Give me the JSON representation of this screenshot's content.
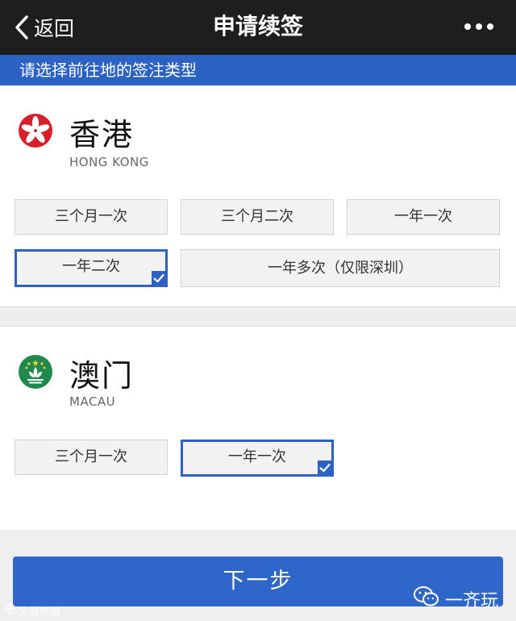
{
  "header": {
    "back_label": "返回",
    "title": "申请续签"
  },
  "banner": {
    "text": "请选择前往地的签注类型"
  },
  "regions": [
    {
      "name": "香港",
      "name_en": "HONG KONG",
      "options": [
        "三个月一次",
        "三个月二次",
        "一年一次",
        "一年二次",
        "一年多次（仅限深圳）"
      ],
      "selected": "一年二次"
    },
    {
      "name": "澳门",
      "name_en": "MACAU",
      "options": [
        "三个月一次",
        "一年一次"
      ],
      "selected": "一年一次"
    }
  ],
  "next_button": {
    "label": "下一步"
  },
  "watermarks": {
    "left": "大数跨境",
    "right": "一齐玩"
  },
  "colors": {
    "accent": "#2b62c4",
    "topbar": "#1e1e1f",
    "hk_flag": "#d71e29",
    "macau_flag": "#1f8a4c"
  }
}
